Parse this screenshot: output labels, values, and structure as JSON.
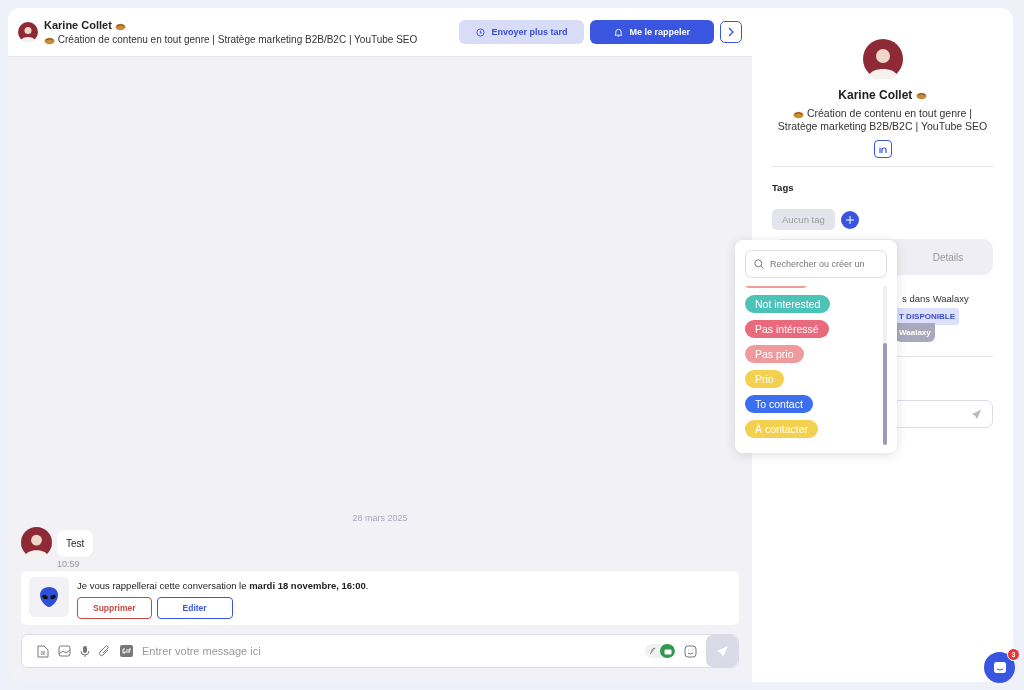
{
  "header": {
    "name": "Karine Collet",
    "headline": "Création de contenu en tout genre | Stratège marketing B2B/B2C | YouTube SEO",
    "buttons": [
      {
        "label": "Envoyer plus tard",
        "kind": "secondary"
      },
      {
        "label": "Me le rappeler",
        "kind": "primary"
      }
    ]
  },
  "conversation": {
    "date": "28 mars 2025",
    "messages": [
      {
        "text": "Test",
        "time": "10:59"
      }
    ],
    "reminder": {
      "text": "Je vous rappellerai cette conversation le **mardi 18 novembre, 16:00**.",
      "buttons": [
        {
          "label": "Supprimer",
          "kind": "danger"
        },
        {
          "label": "Editer",
          "kind": "outline"
        }
      ]
    },
    "composer": {
      "placeholder": "Entrer votre message ici",
      "ai_on": true
    }
  },
  "profile": {
    "name": "Karine Collet",
    "headline": "Création de contenu en tout genre | Stratège marketing B2B/B2C | YouTube SEO",
    "tags_title": "Tags",
    "empty_tag": "Aucun tag",
    "tabs": [
      {
        "label": "Details",
        "selected": false
      }
    ],
    "status_text": "s dans Waalaxy",
    "badges": [
      {
        "label": "T DISPONIBLE",
        "kind": "info"
      },
      {
        "label": "Waalaxy",
        "kind": "muted"
      }
    ]
  },
  "tag_dropdown": {
    "placeholder": "Rechercher ou créer un",
    "tags": [
      {
        "label": "Not interested",
        "color": "#4cc3b8"
      },
      {
        "label": "Pas intéressé",
        "color": "#e86a7c"
      },
      {
        "label": "Pas prio",
        "color": "#ef9a9c"
      },
      {
        "label": "Prio",
        "color": "#f3d04f"
      },
      {
        "label": "To contact",
        "color": "#3b6ff0"
      },
      {
        "label": "À contacter",
        "color": "#f3d04f"
      }
    ]
  },
  "chat_widget": {
    "count": "3"
  }
}
